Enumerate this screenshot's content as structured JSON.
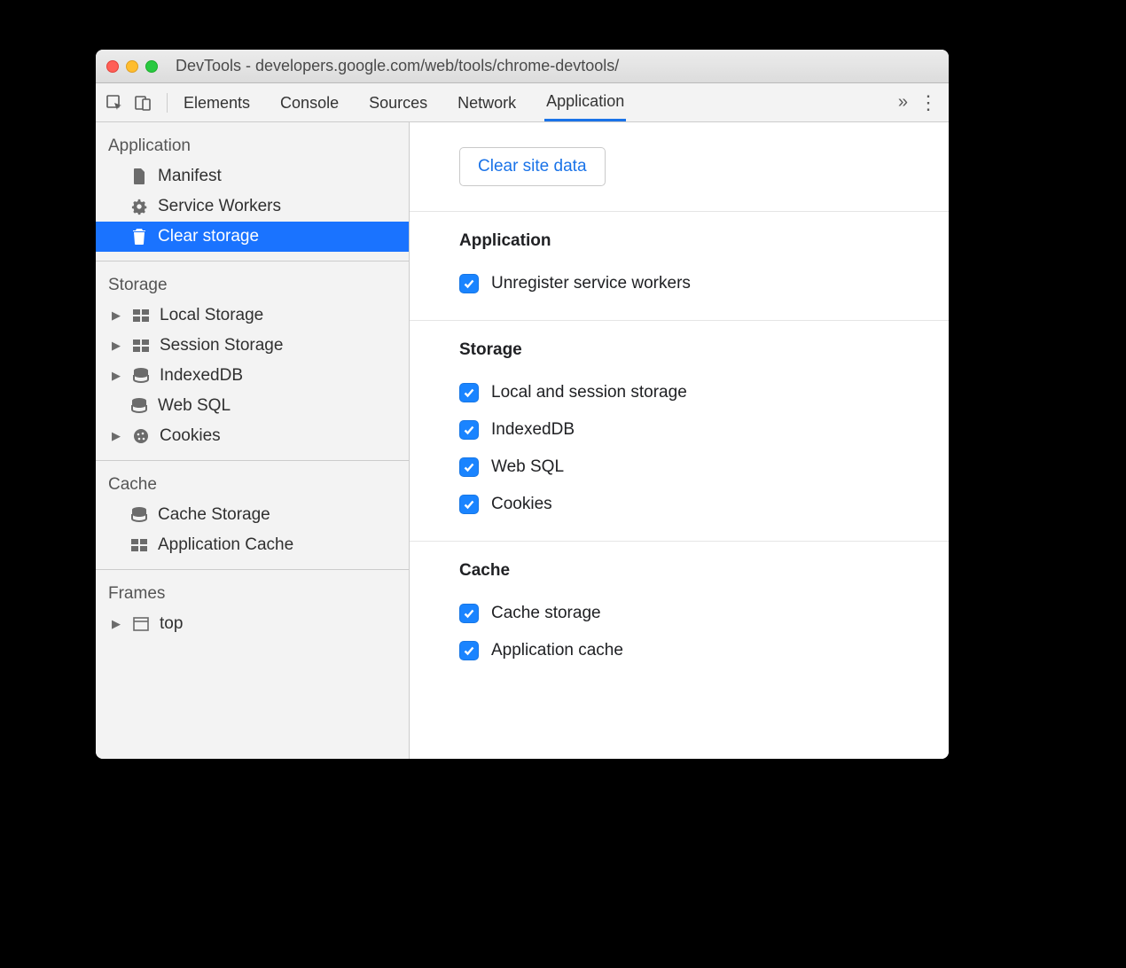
{
  "window": {
    "title": "DevTools - developers.google.com/web/tools/chrome-devtools/"
  },
  "tabs": {
    "elements": "Elements",
    "console": "Console",
    "sources": "Sources",
    "network": "Network",
    "application": "Application"
  },
  "sidebar": {
    "application": {
      "header": "Application",
      "manifest": "Manifest",
      "service_workers": "Service Workers",
      "clear_storage": "Clear storage"
    },
    "storage": {
      "header": "Storage",
      "local": "Local Storage",
      "session": "Session Storage",
      "indexeddb": "IndexedDB",
      "websql": "Web SQL",
      "cookies": "Cookies"
    },
    "cache": {
      "header": "Cache",
      "cache_storage": "Cache Storage",
      "app_cache": "Application Cache"
    },
    "frames": {
      "header": "Frames",
      "top": "top"
    }
  },
  "main": {
    "clear_btn": "Clear site data",
    "application": {
      "header": "Application",
      "unregister_sw": "Unregister service workers"
    },
    "storage": {
      "header": "Storage",
      "local_session": "Local and session storage",
      "indexeddb": "IndexedDB",
      "websql": "Web SQL",
      "cookies": "Cookies"
    },
    "cache": {
      "header": "Cache",
      "cache_storage": "Cache storage",
      "app_cache": "Application cache"
    }
  }
}
